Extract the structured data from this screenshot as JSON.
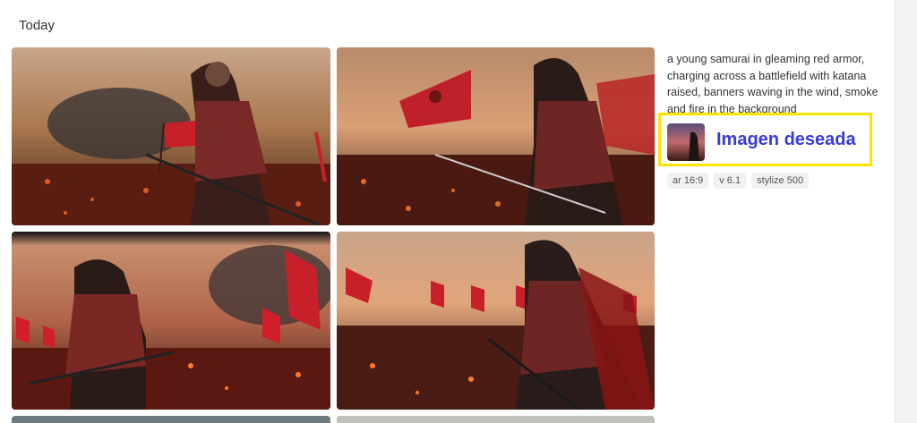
{
  "section": {
    "title": "Today"
  },
  "prompt": {
    "text": "a young samurai in gleaming red armor, charging across a battlefield with katana raised, banners waving in the wind, smoke and fire in the background"
  },
  "annotation": {
    "text": "Imagen deseada"
  },
  "params": [
    "ar 16:9",
    "v 6.1",
    "stylize 500"
  ],
  "colors": {
    "highlight": "#ffe300",
    "annotation": "#3a3adb"
  }
}
